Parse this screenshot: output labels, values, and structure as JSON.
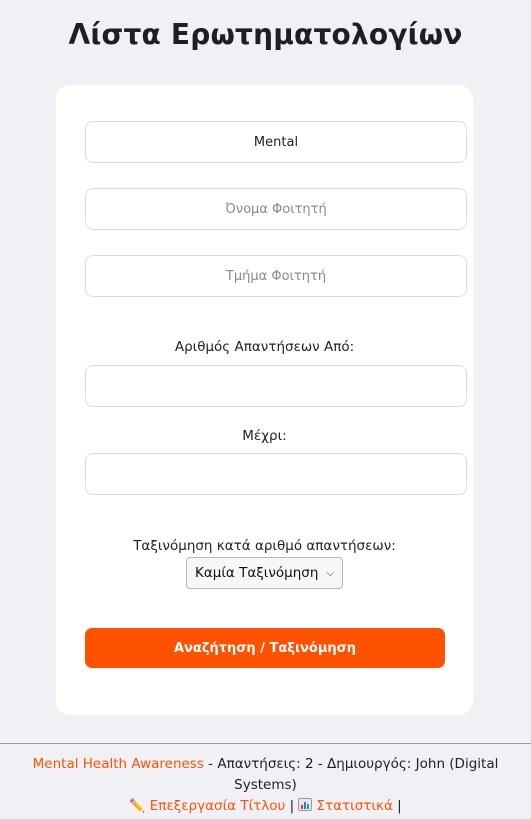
{
  "page": {
    "title": "Λίστα Ερωτηματολογίων"
  },
  "filters": {
    "questionnaire_title_value": "Mental",
    "student_name_placeholder": "Όνομα Φοιτητή",
    "student_department_placeholder": "Τμήμα Φοιτητή",
    "answers_from_label": "Αριθμός Απαντήσεων Από:",
    "answers_from_value": "",
    "answers_to_label": "Μέχρι:",
    "answers_to_value": "",
    "sort_label": "Ταξινόμηση κατά αριθμό απαντήσεων:",
    "sort_selected": "Καμία Ταξινόμηση",
    "submit_label": "Αναζήτηση / Ταξινόμηση"
  },
  "colors": {
    "accent": "#ff5200",
    "background": "#f0f0f5",
    "card": "#ffffff"
  },
  "results": [
    {
      "title": "Mental Health Awareness",
      "meta": " - Απαντήσεις: 2 - Δημιουργός: John (Digital Systems)",
      "edit_icon": "pencil-icon",
      "edit_label": "Επεξεργασία Τίτλου",
      "separator_1": " | ",
      "stats_icon": "bar-chart-icon",
      "stats_label": "Στατιστικά",
      "separator_2": " |"
    }
  ]
}
